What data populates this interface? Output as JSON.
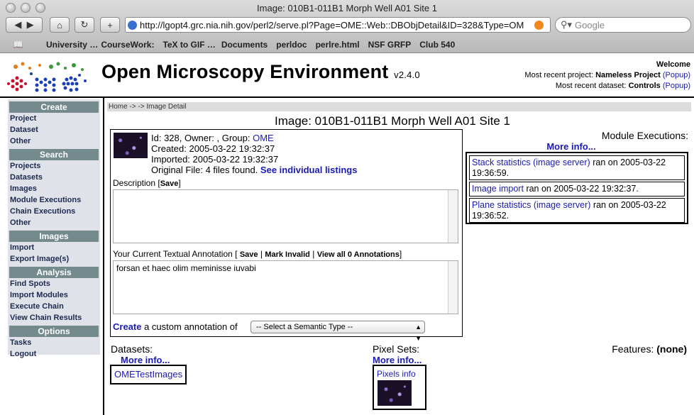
{
  "browser": {
    "window_title": "Image: 010B1-011B1 Morph Well A01 Site 1",
    "url": "http://lgopt4.grc.nia.nih.gov/perl2/serve.pl?Page=OME::Web::DBObjDetail&ID=328&Type=OM",
    "search_placeholder": "Google",
    "bookmarks": [
      "University …",
      "CourseWork:",
      "TeX to GIF …",
      "Documents",
      "perldoc",
      "perlre.html",
      "NSF GRFP",
      "Club 540"
    ]
  },
  "header": {
    "title": "Open Microscopy Environment",
    "version": "v2.4.0",
    "welcome": "Welcome",
    "recent_project_label": "Most recent project:",
    "recent_project": "Nameless Project",
    "recent_dataset_label": "Most recent dataset:",
    "recent_dataset": "Controls",
    "popup": "(Popup)"
  },
  "sidebar": {
    "create_head": "Create",
    "create_items": [
      "Project",
      "Dataset",
      "Other"
    ],
    "search_head": "Search",
    "search_items": [
      "Projects",
      "Datasets",
      "Images",
      "Module Executions",
      "Chain Executions",
      "Other"
    ],
    "images_head": "Images",
    "images_items": [
      "Import",
      "Export Image(s)"
    ],
    "analysis_head": "Analysis",
    "analysis_items": [
      "Find Spots",
      "Import Modules",
      "Execute Chain",
      "View Chain Results"
    ],
    "options_head": "Options",
    "options_items": [
      "Tasks",
      "Logout"
    ]
  },
  "main": {
    "breadcrumb": "Home -> -> Image Detail",
    "image_title": "Image: 010B1-011B1 Morph Well A01 Site 1",
    "id_line": "Id: 328, Owner: , Group:",
    "group": "OME",
    "created": "Created: 2005-03-22 19:32:37",
    "imported": "Imported: 2005-03-22 19:32:37",
    "original_file": "Original File: 4 files found.",
    "see_listings": "See individual listings",
    "description_label": "Description",
    "save": "Save",
    "description_value": "",
    "annotation_label": "Your Current Textual Annotation",
    "mark_invalid": "Mark Invalid",
    "view_all": "View all 0 Annotations",
    "annotation_value": "forsan et haec olim meminisse iuvabi",
    "create_link": "Create",
    "create_text": "a custom annotation of",
    "semantic_type": "-- Select a Semantic Type --"
  },
  "module_executions": {
    "title": "Module Executions:",
    "more_info": "More info...",
    "items": [
      {
        "link": "Stack statistics (image server)",
        "text": "ran on 2005-03-22 19:36:59."
      },
      {
        "link": "Image import",
        "text": "ran on 2005-03-22 19:32:37."
      },
      {
        "link": "Plane statistics (image server)",
        "text": "ran on 2005-03-22 19:36:52."
      }
    ]
  },
  "bottom": {
    "datasets_label": "Datasets:",
    "datasets_more": "More info...",
    "dataset_name": "OMETestImages",
    "pixels_label": "Pixel Sets:",
    "pixels_more": "More info...",
    "pixels_info": "Pixels info",
    "features_label": "Features:",
    "features_value": "(none)"
  }
}
